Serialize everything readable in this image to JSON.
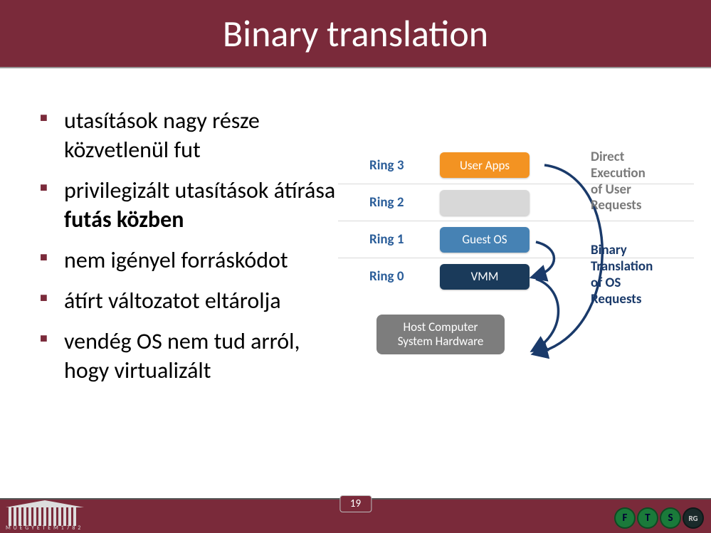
{
  "title": "Binary translation",
  "bullets": [
    {
      "pre": "utasítások nagy része közvetlenül fut",
      "bold": "",
      "post": ""
    },
    {
      "pre": "privilegizált utasítások átírása ",
      "bold": "futás közben",
      "post": ""
    },
    {
      "pre": "nem igényel forráskódot",
      "bold": "",
      "post": ""
    },
    {
      "pre": "átírt változatot eltárolja",
      "bold": "",
      "post": ""
    },
    {
      "pre": "vendég OS nem tud arról, hogy virtualizált",
      "bold": "",
      "post": ""
    }
  ],
  "diagram": {
    "rings": [
      {
        "label": "Ring 3",
        "box": "User Apps",
        "style": "orange"
      },
      {
        "label": "Ring 2",
        "box": "",
        "style": "gray"
      },
      {
        "label": "Ring 1",
        "box": "Guest OS",
        "style": "blue"
      },
      {
        "label": "Ring 0",
        "box": "VMM",
        "style": "navy"
      }
    ],
    "host": "Host Computer\nSystem Hardware",
    "side": {
      "direct": "Direct\nExecution\nof User\nRequests",
      "binary": "Binary\nTranslation\nof OS\nRequests"
    }
  },
  "page_number": "19",
  "logo_left_text": "M Ű E G Y E T E M  1 7 8 2",
  "logo_right": {
    "letters": [
      "F",
      "T",
      "S"
    ],
    "small": "RG"
  }
}
